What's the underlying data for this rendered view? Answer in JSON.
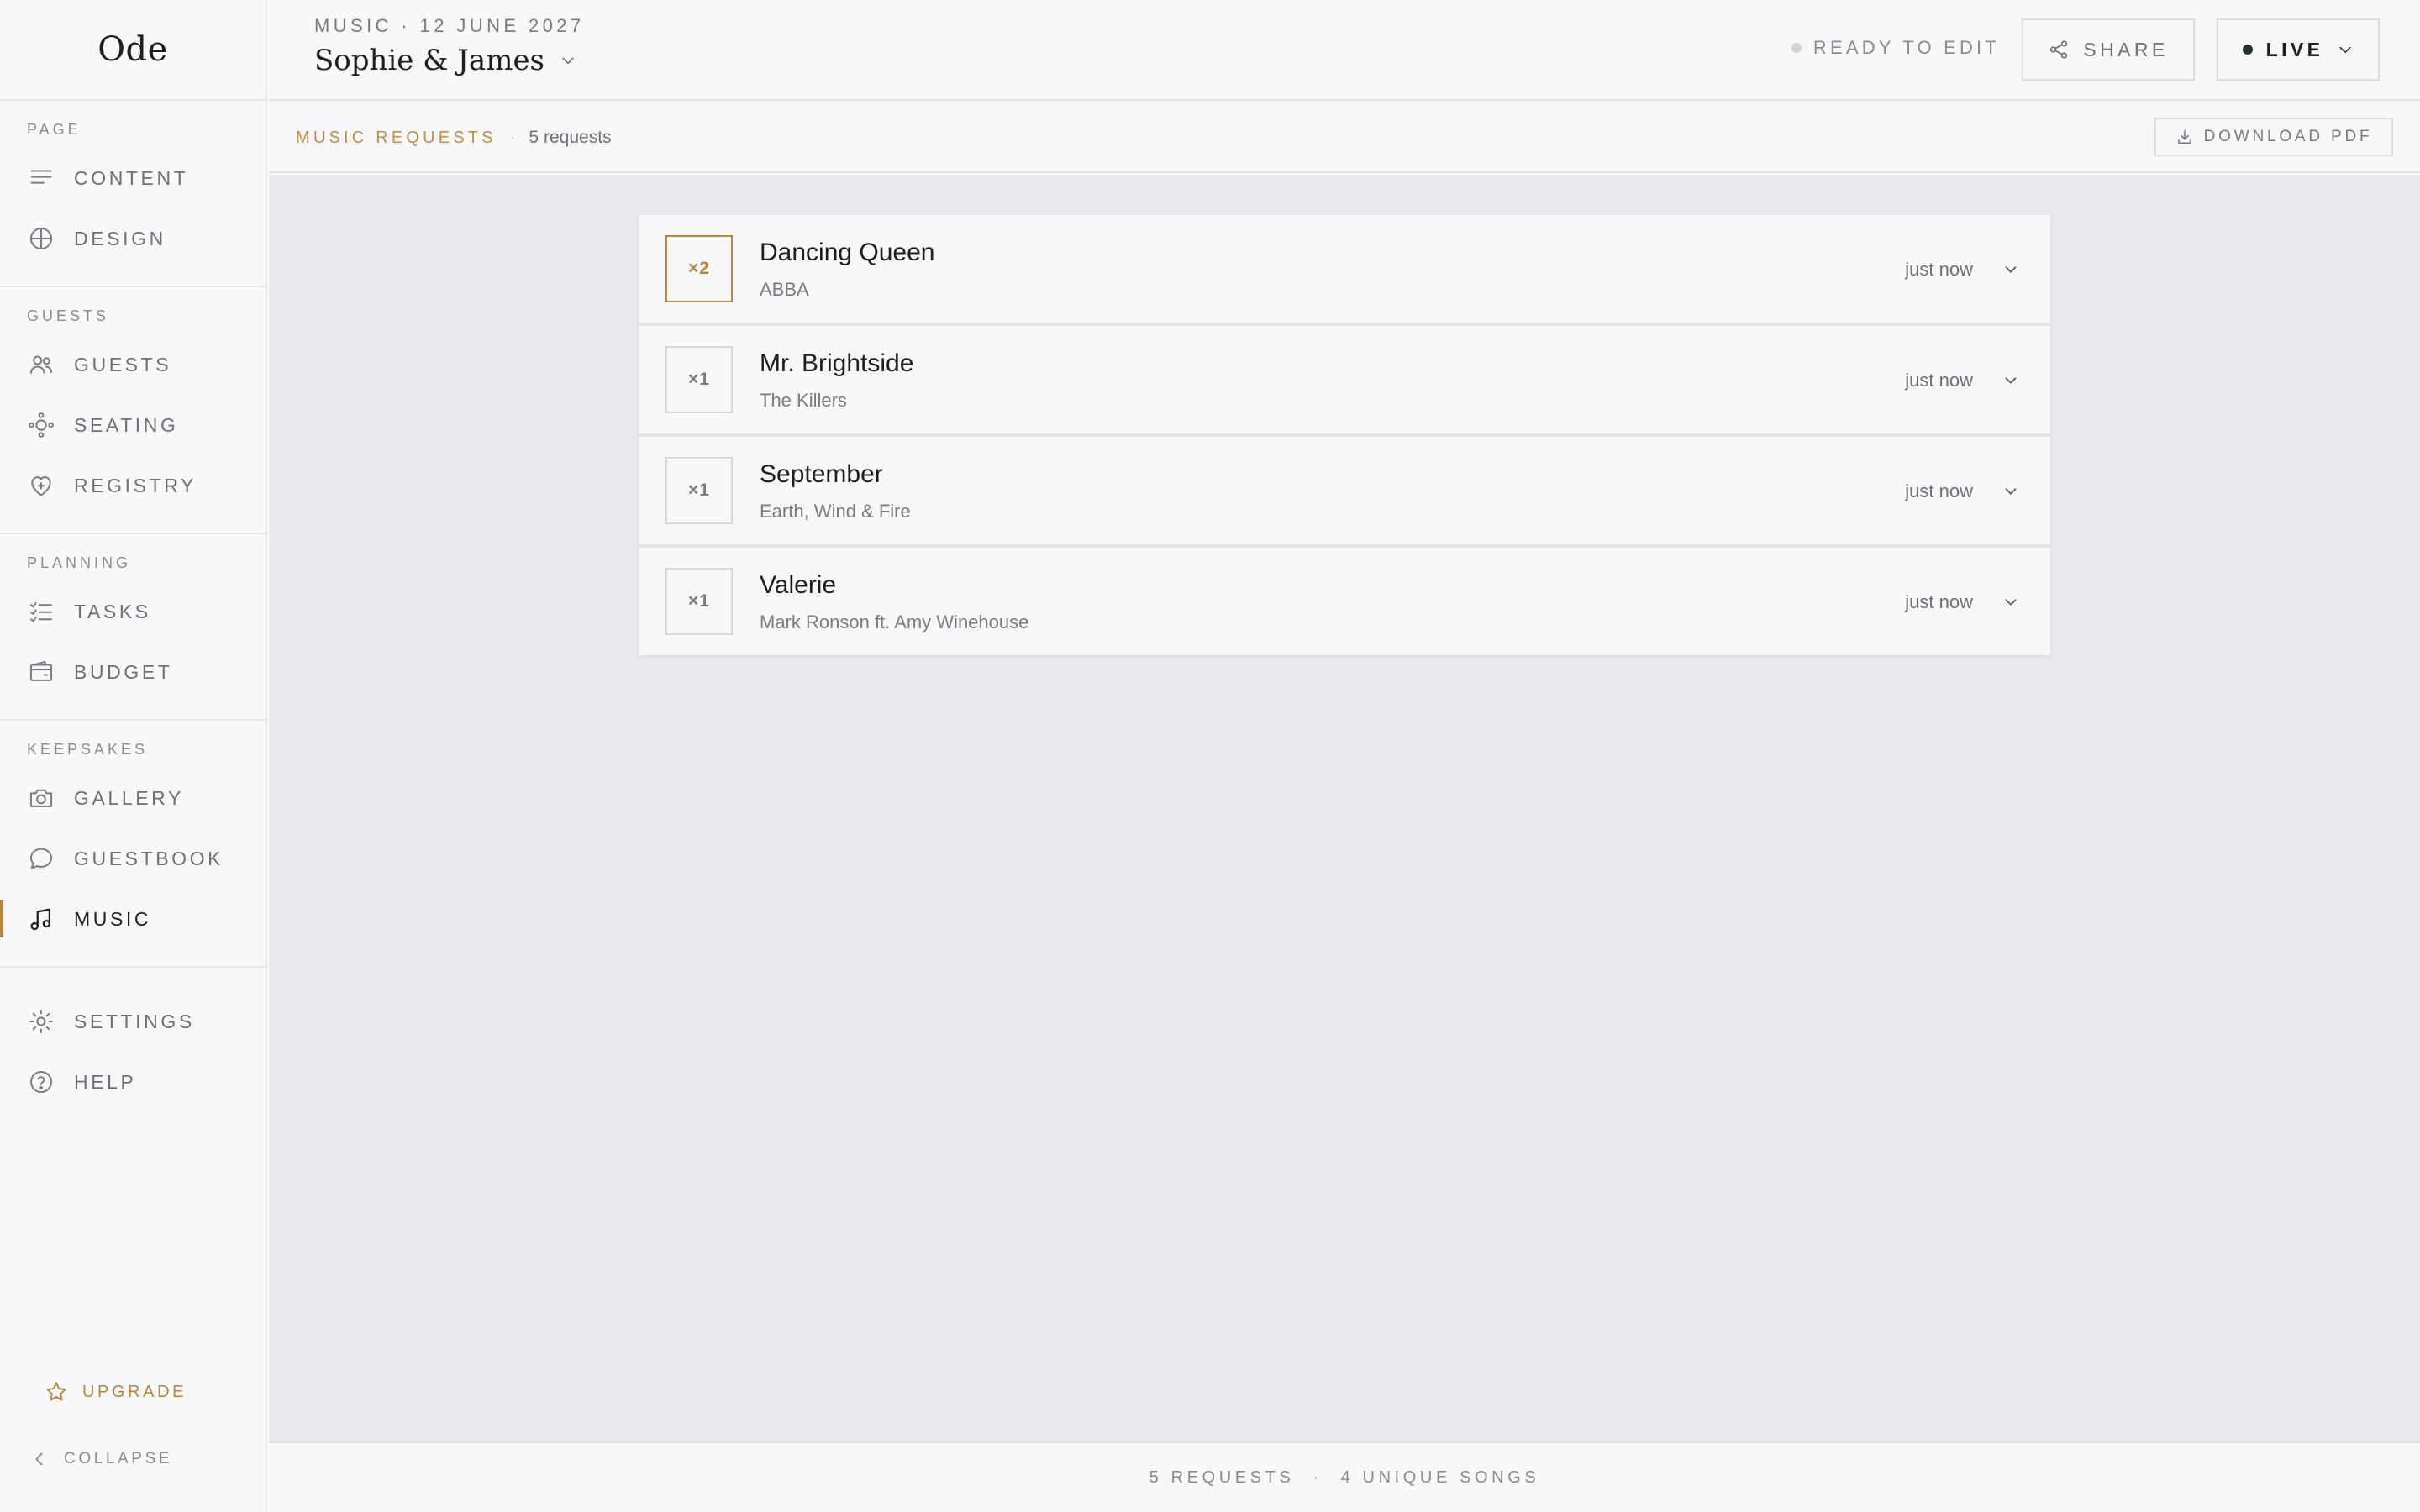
{
  "app": {
    "logo": "Ode"
  },
  "sidebar": {
    "sections": [
      {
        "label": "PAGE",
        "items": [
          {
            "label": "CONTENT",
            "icon": "content-icon"
          },
          {
            "label": "DESIGN",
            "icon": "design-icon"
          }
        ]
      },
      {
        "label": "GUESTS",
        "items": [
          {
            "label": "GUESTS",
            "icon": "guests-icon"
          },
          {
            "label": "SEATING",
            "icon": "seating-icon"
          },
          {
            "label": "REGISTRY",
            "icon": "registry-icon"
          }
        ]
      },
      {
        "label": "PLANNING",
        "items": [
          {
            "label": "TASKS",
            "icon": "tasks-icon"
          },
          {
            "label": "BUDGET",
            "icon": "budget-icon"
          }
        ]
      },
      {
        "label": "KEEPSAKES",
        "items": [
          {
            "label": "GALLERY",
            "icon": "camera-icon"
          },
          {
            "label": "GUESTBOOK",
            "icon": "chat-icon"
          },
          {
            "label": "MUSIC",
            "icon": "music-icon",
            "active": true
          }
        ]
      },
      {
        "label": "",
        "items": [
          {
            "label": "SETTINGS",
            "icon": "gear-icon"
          },
          {
            "label": "HELP",
            "icon": "help-icon"
          }
        ]
      }
    ],
    "upgrade_label": "UPGRADE",
    "collapse_label": "COLLAPSE"
  },
  "header": {
    "breadcrumb": "MUSIC · 12 JUNE 2027",
    "event_name": "Sophie & James",
    "status": "READY TO EDIT",
    "share_label": "SHARE",
    "live_label": "LIVE"
  },
  "subheader": {
    "title": "MUSIC REQUESTS",
    "separator": "·",
    "count": "5 requests",
    "download_label": "DOWNLOAD PDF"
  },
  "requests": [
    {
      "count": "×2",
      "title": "Dancing Queen",
      "artist": "ABBA",
      "time": "just now",
      "highlight": true
    },
    {
      "count": "×1",
      "title": "Mr. Brightside",
      "artist": "The Killers",
      "time": "just now",
      "highlight": false
    },
    {
      "count": "×1",
      "title": "September",
      "artist": "Earth, Wind & Fire",
      "time": "just now",
      "highlight": false
    },
    {
      "count": "×1",
      "title": "Valerie",
      "artist": "Mark Ronson ft. Amy Winehouse",
      "time": "just now",
      "highlight": false
    }
  ],
  "footer": {
    "requests": "5 REQUESTS",
    "separator": "·",
    "unique": "4 UNIQUE SONGS"
  },
  "colors": {
    "accent": "#b8863b",
    "main_bg": "#e8e8ed",
    "panel_bg": "#f8f8fa"
  }
}
